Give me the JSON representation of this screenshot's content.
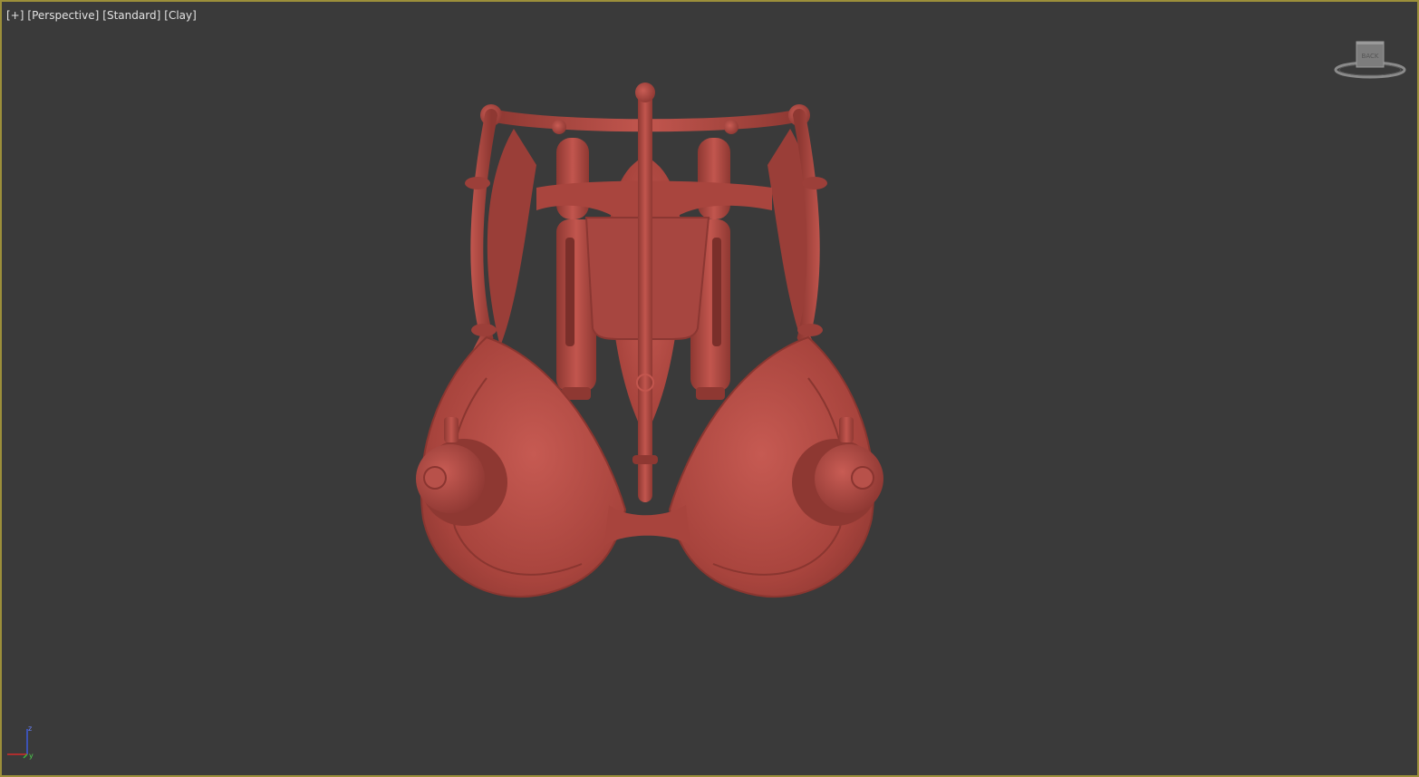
{
  "viewport": {
    "labels": [
      "[+]",
      "[Perspective]",
      "[Standard]",
      "[Clay]"
    ],
    "border_color": "#9c8f3a",
    "background_color": "#3a3a3a"
  },
  "viewcube": {
    "face_label": "BACK"
  },
  "axis_tripod": {
    "z_label": "z",
    "y_label": "y"
  },
  "model": {
    "icon": "clay-harness-model",
    "color": "#b24b44"
  }
}
